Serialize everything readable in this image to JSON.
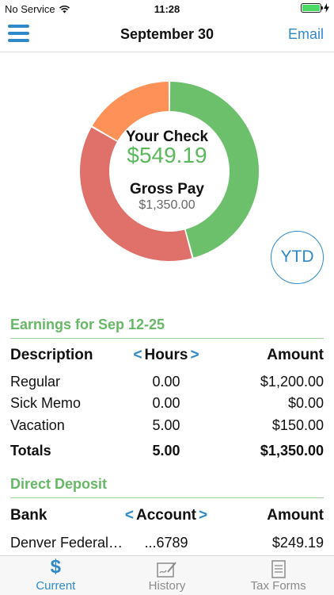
{
  "status_bar": {
    "carrier": "No Service",
    "time": "11:28"
  },
  "nav": {
    "title": "September 30",
    "email_label": "Email"
  },
  "paycheck": {
    "your_check_label": "Your Check",
    "your_check_amount": "$549.19",
    "gross_pay_label": "Gross Pay",
    "gross_pay_amount": "$1,350.00",
    "ytd_label": "YTD"
  },
  "chart_data": {
    "type": "pie",
    "values": [
      549.19,
      450.0,
      200.0
    ],
    "colors": [
      "#6cc06c",
      "#e0706a",
      "#fd9158"
    ]
  },
  "earnings": {
    "title": "Earnings for Sep 12-25",
    "headers": {
      "description": "Description",
      "hours": "Hours",
      "amount": "Amount"
    },
    "rows": [
      {
        "description": "Regular",
        "hours": "0.00",
        "amount": "$1,200.00"
      },
      {
        "description": "Sick Memo",
        "hours": "0.00",
        "amount": "$0.00"
      },
      {
        "description": "Vacation",
        "hours": "5.00",
        "amount": "$150.00"
      }
    ],
    "totals": {
      "label": "Totals",
      "hours": "5.00",
      "amount": "$1,350.00"
    }
  },
  "deposit": {
    "title": "Direct Deposit",
    "headers": {
      "bank": "Bank",
      "account": "Account",
      "amount": "Amount"
    },
    "rows": [
      {
        "bank": "Denver Federal…",
        "account": "...6789",
        "amount": "$249.19"
      }
    ]
  },
  "tabs": [
    {
      "label": "Current",
      "icon": "dollar-icon",
      "active": true
    },
    {
      "label": "History",
      "icon": "history-icon",
      "active": false
    },
    {
      "label": "Tax Forms",
      "icon": "document-icon",
      "active": false
    }
  ],
  "colors": {
    "accent": "#2f89c9",
    "green": "#66b866"
  }
}
